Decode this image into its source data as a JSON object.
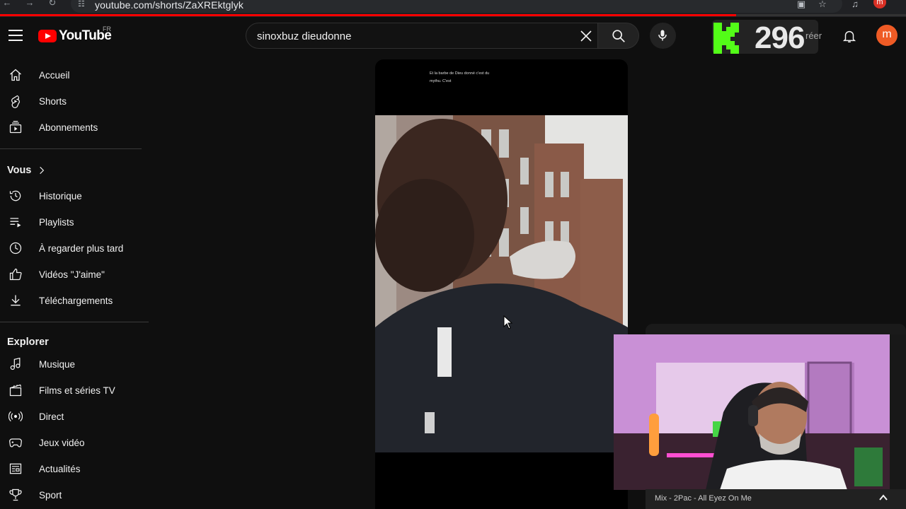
{
  "browser": {
    "url": "youtube.com/shorts/ZaXREktglyk",
    "profile_initial": "m"
  },
  "masthead": {
    "logo_text": "YouTube",
    "region": "FR",
    "search_value": "sinoxbuz dieudonne",
    "avatar_initial": "m"
  },
  "overlay": {
    "kick_count": "296",
    "partial_text": "réer"
  },
  "sidebar": {
    "main": [
      {
        "label": "Accueil",
        "icon": "home-icon"
      },
      {
        "label": "Shorts",
        "icon": "shorts-icon"
      },
      {
        "label": "Abonnements",
        "icon": "subscriptions-icon"
      }
    ],
    "you_title": "Vous",
    "you": [
      {
        "label": "Historique",
        "icon": "history-icon"
      },
      {
        "label": "Playlists",
        "icon": "playlists-icon"
      },
      {
        "label": "À regarder plus tard",
        "icon": "clock-icon"
      },
      {
        "label": "Vidéos \"J'aime\"",
        "icon": "thumbs-up-icon"
      },
      {
        "label": "Téléchargements",
        "icon": "download-icon"
      }
    ],
    "explore_title": "Explorer",
    "explore": [
      {
        "label": "Musique",
        "icon": "music-icon"
      },
      {
        "label": "Films et séries TV",
        "icon": "film-icon"
      },
      {
        "label": "Direct",
        "icon": "live-icon"
      },
      {
        "label": "Jeux vidéo",
        "icon": "gamepad-icon"
      },
      {
        "label": "Actualités",
        "icon": "news-icon"
      },
      {
        "label": "Sport",
        "icon": "trophy-icon"
      }
    ]
  },
  "short": {
    "caption_line1": "Et la barbe de Dieu donné c'est du",
    "caption_line2": "mythu. C'est"
  },
  "miniplayer": {
    "title": "Mix - 2Pac - All Eyez On Me"
  },
  "colors": {
    "brand_red": "#ff0000",
    "kick_green": "#53fc18",
    "avatar": "#ef5b25"
  }
}
